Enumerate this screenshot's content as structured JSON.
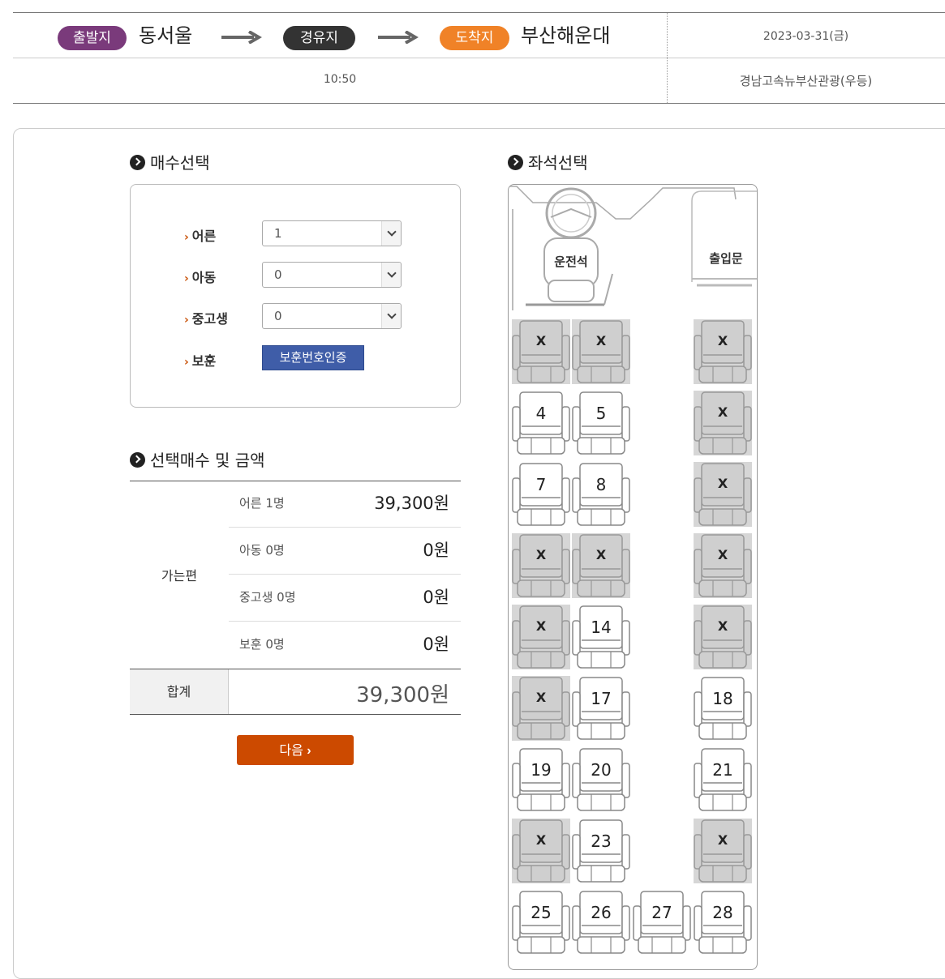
{
  "route": {
    "departure_badge": "출발지",
    "departure": "동서울",
    "via_badge": "경유지",
    "arrival_badge": "도착지",
    "arrival": "부산해운대",
    "date": "2023-03-31(금)",
    "time": "10:50",
    "company": "경남고속뉴부산관광(우등)"
  },
  "count_section": {
    "title": "매수선택",
    "rows": [
      {
        "label": "어른",
        "value": "1"
      },
      {
        "label": "아동",
        "value": "0"
      },
      {
        "label": "중고생",
        "value": "0"
      },
      {
        "label": "보훈",
        "button": "보훈번호인증"
      }
    ]
  },
  "summary": {
    "title": "선택매수 및 금액",
    "trip_label": "가는편",
    "lines": [
      {
        "label": "어른 1명",
        "amount": "39,300원"
      },
      {
        "label": "아동 0명",
        "amount": "0원"
      },
      {
        "label": "중고생 0명",
        "amount": "0원"
      },
      {
        "label": "보훈 0명",
        "amount": "0원"
      }
    ],
    "total_label": "합계",
    "total_amount": "39,300원",
    "next_button": "다음"
  },
  "seat_section": {
    "title": "좌석선택",
    "driver_label": "운전석",
    "entrance_label": "출입문",
    "taken_mark": "X",
    "seats": [
      {
        "col": 0,
        "row": 0,
        "label": "X",
        "taken": true
      },
      {
        "col": 1,
        "row": 0,
        "label": "X",
        "taken": true
      },
      {
        "col": 3,
        "row": 0,
        "label": "X",
        "taken": true
      },
      {
        "col": 0,
        "row": 1,
        "label": "4",
        "taken": false
      },
      {
        "col": 1,
        "row": 1,
        "label": "5",
        "taken": false
      },
      {
        "col": 3,
        "row": 1,
        "label": "X",
        "taken": true
      },
      {
        "col": 0,
        "row": 2,
        "label": "7",
        "taken": false
      },
      {
        "col": 1,
        "row": 2,
        "label": "8",
        "taken": false
      },
      {
        "col": 3,
        "row": 2,
        "label": "X",
        "taken": true
      },
      {
        "col": 0,
        "row": 3,
        "label": "X",
        "taken": true
      },
      {
        "col": 1,
        "row": 3,
        "label": "X",
        "taken": true
      },
      {
        "col": 3,
        "row": 3,
        "label": "X",
        "taken": true
      },
      {
        "col": 0,
        "row": 4,
        "label": "X",
        "taken": true
      },
      {
        "col": 1,
        "row": 4,
        "label": "14",
        "taken": false
      },
      {
        "col": 3,
        "row": 4,
        "label": "X",
        "taken": true
      },
      {
        "col": 0,
        "row": 5,
        "label": "X",
        "taken": true
      },
      {
        "col": 1,
        "row": 5,
        "label": "17",
        "taken": false
      },
      {
        "col": 3,
        "row": 5,
        "label": "18",
        "taken": false
      },
      {
        "col": 0,
        "row": 6,
        "label": "19",
        "taken": false
      },
      {
        "col": 1,
        "row": 6,
        "label": "20",
        "taken": false
      },
      {
        "col": 3,
        "row": 6,
        "label": "21",
        "taken": false
      },
      {
        "col": 0,
        "row": 7,
        "label": "X",
        "taken": true
      },
      {
        "col": 1,
        "row": 7,
        "label": "23",
        "taken": false
      },
      {
        "col": 3,
        "row": 7,
        "label": "X",
        "taken": true
      },
      {
        "col": 0,
        "row": 8,
        "label": "25",
        "taken": false
      },
      {
        "col": 1,
        "row": 8,
        "label": "26",
        "taken": false
      },
      {
        "col": 2,
        "row": 8,
        "label": "27",
        "taken": false
      },
      {
        "col": 3,
        "row": 8,
        "label": "28",
        "taken": false
      }
    ]
  },
  "colors": {
    "departure_badge": "#7a3a7b",
    "via_badge": "#333333",
    "arrival_badge": "#f08227",
    "verify_button": "#3f5da8",
    "next_button": "#cc4a00",
    "taken_seat": "#cfcfcf"
  }
}
